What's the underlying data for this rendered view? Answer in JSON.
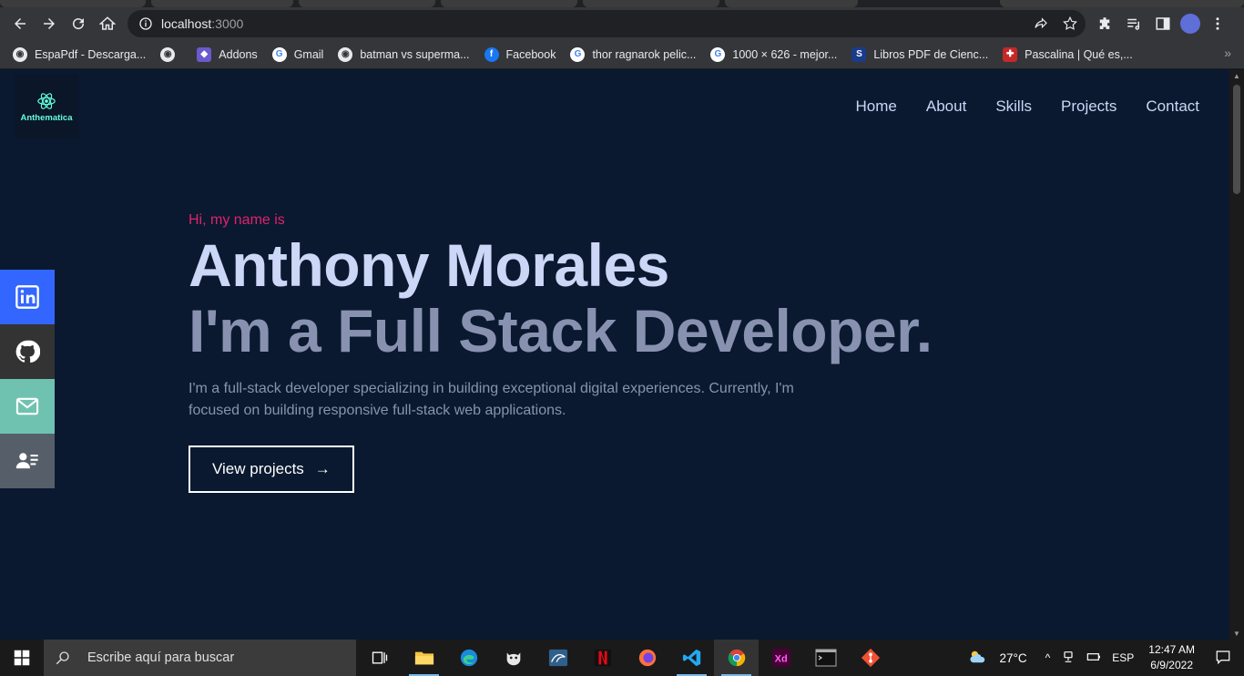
{
  "browser": {
    "url_host": "localhost",
    "url_port": ":3000",
    "bookmarks": [
      {
        "label": "EspaPdf - Descarga...",
        "icon": "globe-icon"
      },
      {
        "label": "",
        "icon": "globe-icon"
      },
      {
        "label": "Addons",
        "icon": "addons-icon"
      },
      {
        "label": "Gmail",
        "icon": "google-icon"
      },
      {
        "label": "batman vs superma...",
        "icon": "globe-icon"
      },
      {
        "label": "Facebook",
        "icon": "facebook-icon"
      },
      {
        "label": "thor ragnarok pelic...",
        "icon": "google-icon"
      },
      {
        "label": "1000 × 626 - mejor...",
        "icon": "google-icon"
      },
      {
        "label": "Libros PDF de Cienc...",
        "icon": "s-icon"
      },
      {
        "label": "Pascalina | Qué es,...",
        "icon": "pascalina-icon"
      }
    ],
    "bookmarks_more": "»"
  },
  "site": {
    "logo_text": "Anthematica",
    "nav": [
      "Home",
      "About",
      "Skills",
      "Projects",
      "Contact"
    ],
    "social": [
      "linkedin-icon",
      "github-icon",
      "mail-icon",
      "resume-icon"
    ],
    "hero": {
      "greeting": "Hi, my name is",
      "name": "Anthony Morales",
      "role": "I'm a Full Stack Developer.",
      "description": "I'm a full-stack developer specializing in building exceptional digital experiences. Currently, I'm focused on building responsive full-stack web applications.",
      "cta_label": "View projects",
      "cta_arrow": "→"
    },
    "colors": {
      "background": "#0a192f",
      "accent": "#e0226e",
      "heading": "#ccd6f6",
      "muted": "#8892b0",
      "logo": "#64ffda"
    }
  },
  "taskbar": {
    "search_placeholder": "Escribe aquí para buscar",
    "weather": "27°C",
    "language": "ESP",
    "time": "12:47 AM",
    "date": "6/9/2022",
    "apps": [
      "task-view-icon",
      "file-explorer-icon",
      "edge-icon",
      "gimp-icon",
      "mysql-workbench-icon",
      "netflix-icon",
      "firefox-icon",
      "vscode-icon",
      "chrome-icon",
      "adobe-xd-icon",
      "terminal-icon",
      "git-icon"
    ]
  }
}
